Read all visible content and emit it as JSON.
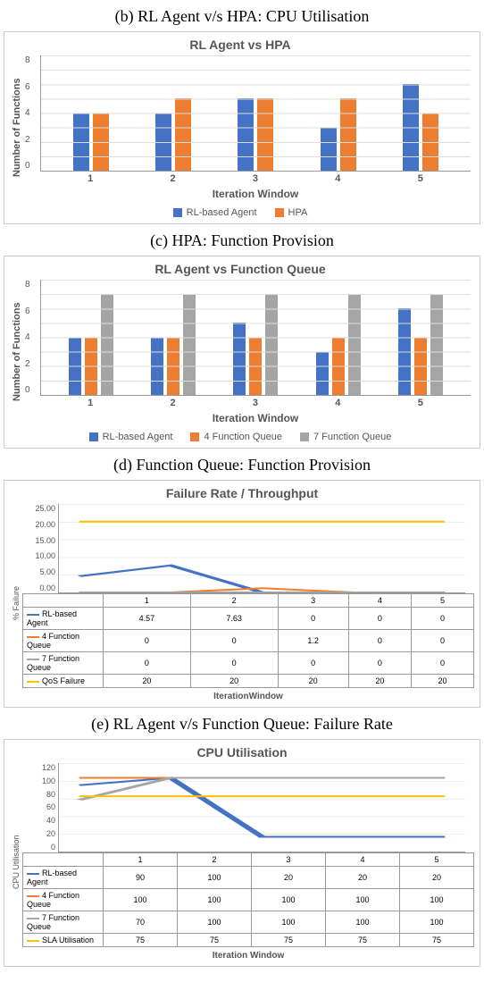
{
  "captions": {
    "b": "(b) RL Agent v/s HPA: CPU Utilisation",
    "c": "(c) HPA: Function Provision",
    "d": "(d) Function Queue: Function Provision",
    "e": "(e) RL Agent v/s Function Queue: Failure Rate"
  },
  "chart_data": [
    {
      "id": "chart_c",
      "type": "bar",
      "title": "RL Agent vs HPA",
      "xlabel": "Iteration Window",
      "ylabel": "Number of Functions",
      "categories": [
        "1",
        "2",
        "3",
        "4",
        "5"
      ],
      "ylim": [
        0,
        8
      ],
      "yticks": [
        "0",
        "2",
        "4",
        "6",
        "8"
      ],
      "series": [
        {
          "name": "RL-based Agent",
          "color": "#4472C4",
          "values": [
            4,
            4,
            5,
            3,
            6
          ]
        },
        {
          "name": "HPA",
          "color": "#ED7D31",
          "values": [
            4,
            5,
            5,
            5,
            4
          ]
        }
      ]
    },
    {
      "id": "chart_d",
      "type": "bar",
      "title": "RL Agent vs Function Queue",
      "xlabel": "Iteration Window",
      "ylabel": "Number of Functions",
      "categories": [
        "1",
        "2",
        "3",
        "4",
        "5"
      ],
      "ylim": [
        0,
        8
      ],
      "yticks": [
        "0",
        "2",
        "4",
        "6",
        "8"
      ],
      "series": [
        {
          "name": "RL-based Agent",
          "color": "#4472C4",
          "values": [
            4,
            4,
            5,
            3,
            6
          ]
        },
        {
          "name": "4 Function Queue",
          "color": "#ED7D31",
          "values": [
            4,
            4,
            4,
            4,
            4
          ]
        },
        {
          "name": "7 Function Queue",
          "color": "#A5A5A5",
          "values": [
            7,
            7,
            7,
            7,
            7
          ]
        }
      ]
    },
    {
      "id": "chart_e",
      "type": "line",
      "title": "Failure Rate / Throughput",
      "xlabel": "IterationWindow",
      "ylabel": "% Failure",
      "categories": [
        "1",
        "2",
        "3",
        "4",
        "5"
      ],
      "ylim": [
        0,
        25
      ],
      "yticks": [
        "0.00",
        "5.00",
        "10.00",
        "15.00",
        "20.00",
        "25.00"
      ],
      "series": [
        {
          "name": "RL-based Agent",
          "color": "#4472C4",
          "values": [
            4.57,
            7.63,
            0.0,
            0.0,
            0.0
          ]
        },
        {
          "name": "4 Function Queue",
          "color": "#ED7D31",
          "values": [
            0,
            0,
            1.2,
            0,
            0
          ]
        },
        {
          "name": "7 Function Queue",
          "color": "#A5A5A5",
          "values": [
            0,
            0,
            0,
            0,
            0
          ]
        },
        {
          "name": "QoS Failure",
          "color": "#FFC000",
          "values": [
            20,
            20,
            20,
            20,
            20
          ]
        }
      ]
    },
    {
      "id": "chart_f",
      "type": "line",
      "title": "CPU Utilisation",
      "xlabel": "Iteration Window",
      "ylabel": "CPU Utilisation",
      "categories": [
        "1",
        "2",
        "3",
        "4",
        "5"
      ],
      "ylim": [
        0,
        120
      ],
      "yticks": [
        "0",
        "20",
        "40",
        "60",
        "80",
        "100",
        "120"
      ],
      "series": [
        {
          "name": "RL-based Agent",
          "color": "#4472C4",
          "values": [
            90,
            100,
            20,
            20,
            20
          ]
        },
        {
          "name": "4 Function Queue",
          "color": "#ED7D31",
          "values": [
            100,
            100,
            100,
            100,
            100
          ]
        },
        {
          "name": "7 Function Queue",
          "color": "#A5A5A5",
          "values": [
            70,
            100,
            100,
            100,
            100
          ]
        },
        {
          "name": "SLA Utilisation",
          "color": "#FFC000",
          "values": [
            75,
            75,
            75,
            75,
            75
          ]
        }
      ]
    }
  ]
}
